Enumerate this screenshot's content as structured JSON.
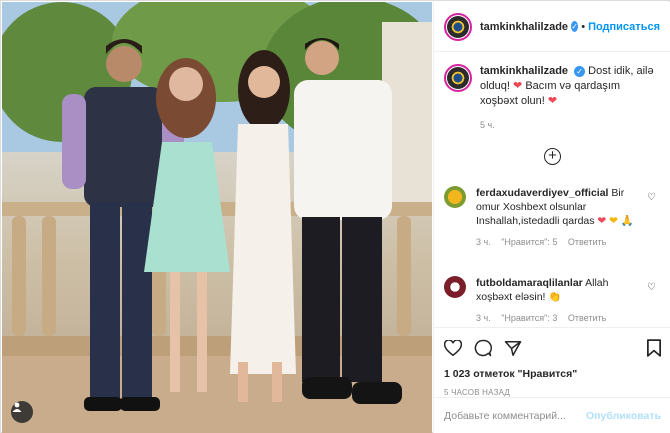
{
  "header": {
    "username": "tamkinkhalilzade",
    "separator": "•",
    "follow_label": "Подписаться"
  },
  "caption": {
    "username": "tamkinkhalilzade",
    "text_1": "Dost idik, ailə olduq!",
    "text_2": "Bacım və qardaşım xoşbəxt olun!",
    "time": "5 ч."
  },
  "comments": [
    {
      "username": "ferdaxudaverdiyev_official",
      "text_1": "Bir omur Xoshbext olsunlar Inshallah,istedadli qardas",
      "time": "3 ч.",
      "likes": "\"Нравится\": 5",
      "reply": "Ответить"
    },
    {
      "username": "futboldamaraqlilanlar",
      "text_1": "Allah xoşbəxt eləsin!",
      "time": "3 ч.",
      "likes": "\"Нравится\": 3",
      "reply": "Ответить"
    }
  ],
  "actions": {
    "likes": "1 023 отметок \"Нравится\"",
    "ago": "5 ЧАСОВ НАЗАД"
  },
  "add_comment": {
    "placeholder": "Добавьте комментарий...",
    "publish_label": "Опубликовать"
  },
  "colors": {
    "accent": "#0095f6",
    "verified": "#3897f0",
    "muted": "#8e8e8e",
    "heart": "#ed4956"
  }
}
